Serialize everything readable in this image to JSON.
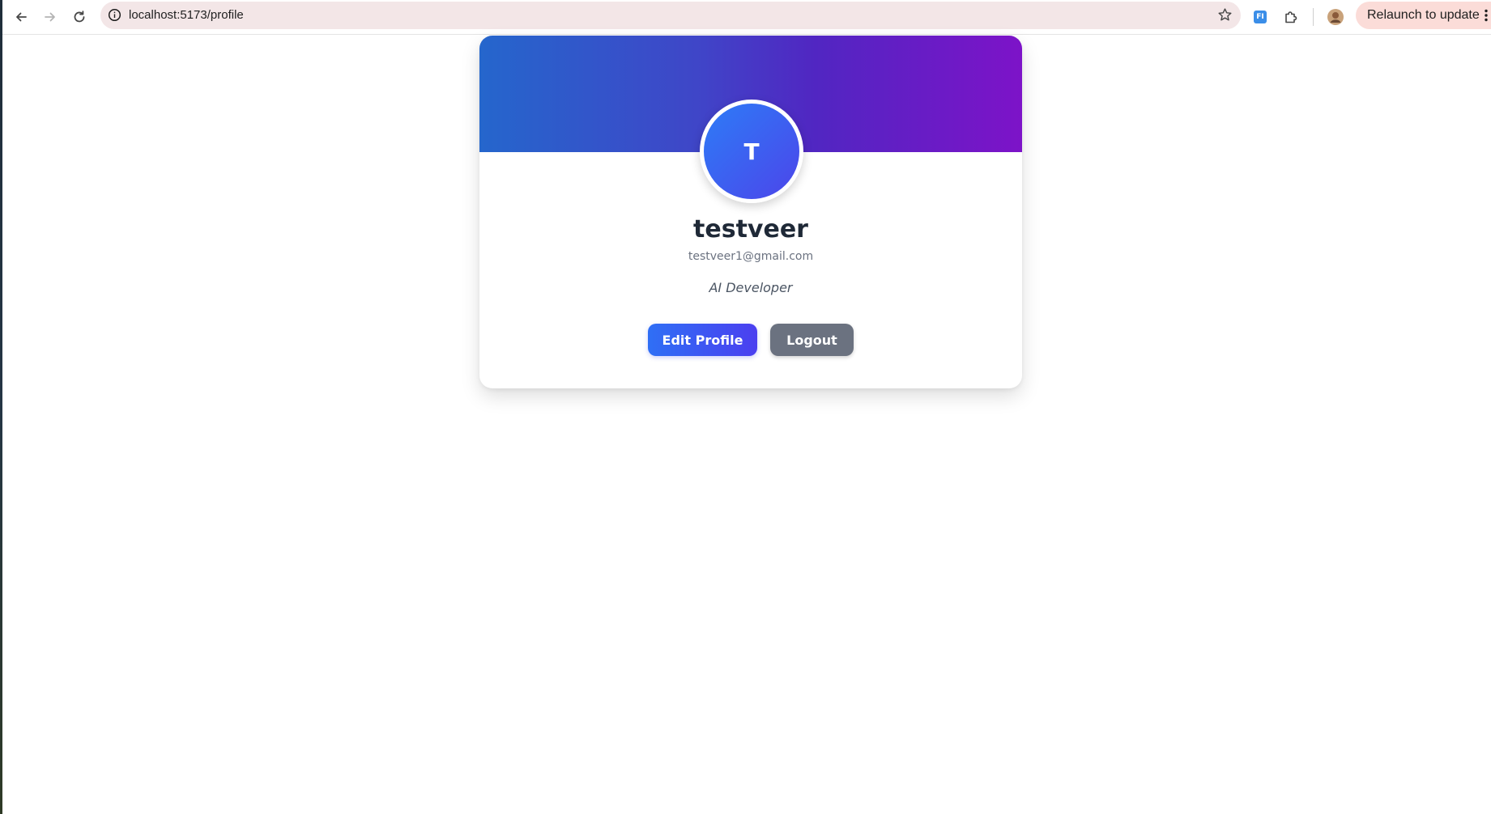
{
  "browser": {
    "url": "localhost:5173/profile",
    "relaunch_label": "Relaunch to update",
    "ext_badge": "FI"
  },
  "profile": {
    "initial": "T",
    "name": "testveer",
    "email": "testveer1@gmail.com",
    "bio": "AI Developer",
    "edit_label": "Edit Profile",
    "logout_label": "Logout"
  },
  "colors": {
    "cover_gradient": [
      "#2566cc",
      "#5126c2",
      "#7d13c8"
    ],
    "avatar_gradient": [
      "#2d7cf7",
      "#4c45ea"
    ],
    "edit_button": "#3b5cf3",
    "logout_button": "#6b7280",
    "relaunch_bg": "#fbdcd8",
    "omnibox_bg": "#f3e6e7"
  }
}
